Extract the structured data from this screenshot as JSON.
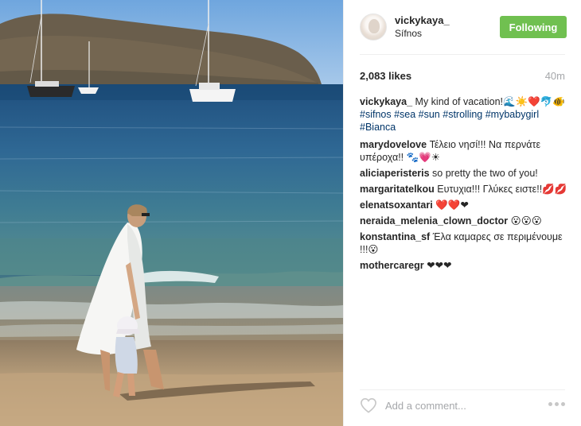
{
  "post": {
    "username": "vickykaya_",
    "location": "Sífnos",
    "follow_label": "Following",
    "likes": "2,083 likes",
    "time": "40m",
    "caption_user": "vickykaya_",
    "caption_text": "My kind of vacation!🌊☀️❤️🐬🐠",
    "hashtags": "#sifnos #sea #sun #strolling #mybabygirl #Bianca",
    "add_comment_placeholder": "Add a comment..."
  },
  "comments": [
    {
      "user": "marydovelove",
      "text": "Τέλειο νησί!!! Να περνάτε υπέροχα!! 🐾💗☀"
    },
    {
      "user": "aliciaperisteris",
      "text": "so pretty the two of you!"
    },
    {
      "user": "margaritatelkou",
      "text": "Ευτυχια!!! Γλύκες ειστε!!💋💋"
    },
    {
      "user": "elenatsoxantari",
      "text": "❤️❤️❤"
    },
    {
      "user": "neraida_melenia_clown_doctor",
      "text": "😮😮😮"
    },
    {
      "user": "konstantina_sf",
      "text": "Έλα καμαρες σε περιμένουμε !!!😮"
    },
    {
      "user": "mothercaregr",
      "text": "❤❤❤"
    }
  ],
  "colors": {
    "follow_green": "#70c050",
    "hashtag_blue": "#003569",
    "muted_gray": "#a5a7aa"
  },
  "icons": {
    "like": "heart-outline-icon",
    "more": "ellipsis-icon"
  }
}
